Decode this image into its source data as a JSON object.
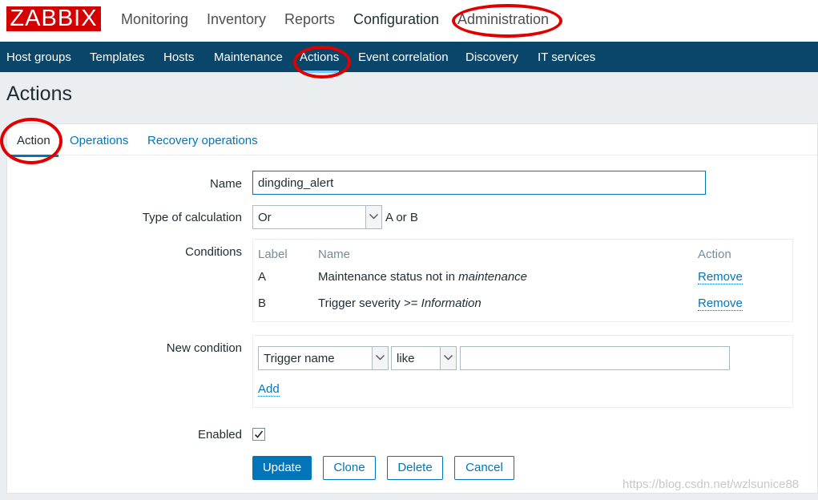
{
  "logo": "ZABBIX",
  "main_menu": [
    "Monitoring",
    "Inventory",
    "Reports",
    "Configuration",
    "Administration"
  ],
  "sub_menu": [
    "Host groups",
    "Templates",
    "Hosts",
    "Maintenance",
    "Actions",
    "Event correlation",
    "Discovery",
    "IT services"
  ],
  "page_title": "Actions",
  "tabs": [
    "Action",
    "Operations",
    "Recovery operations"
  ],
  "form": {
    "name_label": "Name",
    "name_value": "dingding_alert",
    "calc_label": "Type of calculation",
    "calc_value": "Or",
    "calc_formula": "A or B",
    "conditions_label": "Conditions",
    "conditions_headers": {
      "label": "Label",
      "name": "Name",
      "action": "Action"
    },
    "conditions": [
      {
        "label": "A",
        "name_prefix": "Maintenance status not in ",
        "name_italic": "maintenance",
        "action": "Remove"
      },
      {
        "label": "B",
        "name_prefix": "Trigger severity >= ",
        "name_italic": "Information",
        "action": "Remove"
      }
    ],
    "new_condition_label": "New condition",
    "new_condition_type": "Trigger name",
    "new_condition_operator": "like",
    "new_condition_value": "",
    "add_link": "Add",
    "enabled_label": "Enabled",
    "enabled": true
  },
  "buttons": {
    "update": "Update",
    "clone": "Clone",
    "delete": "Delete",
    "cancel": "Cancel"
  },
  "watermark": "https://blog.csdn.net/wzlsunice88",
  "colors": {
    "brand_red": "#d40000",
    "nav_blue": "#0a466a",
    "link_blue": "#0275b8",
    "annotation_red": "#e00000"
  }
}
